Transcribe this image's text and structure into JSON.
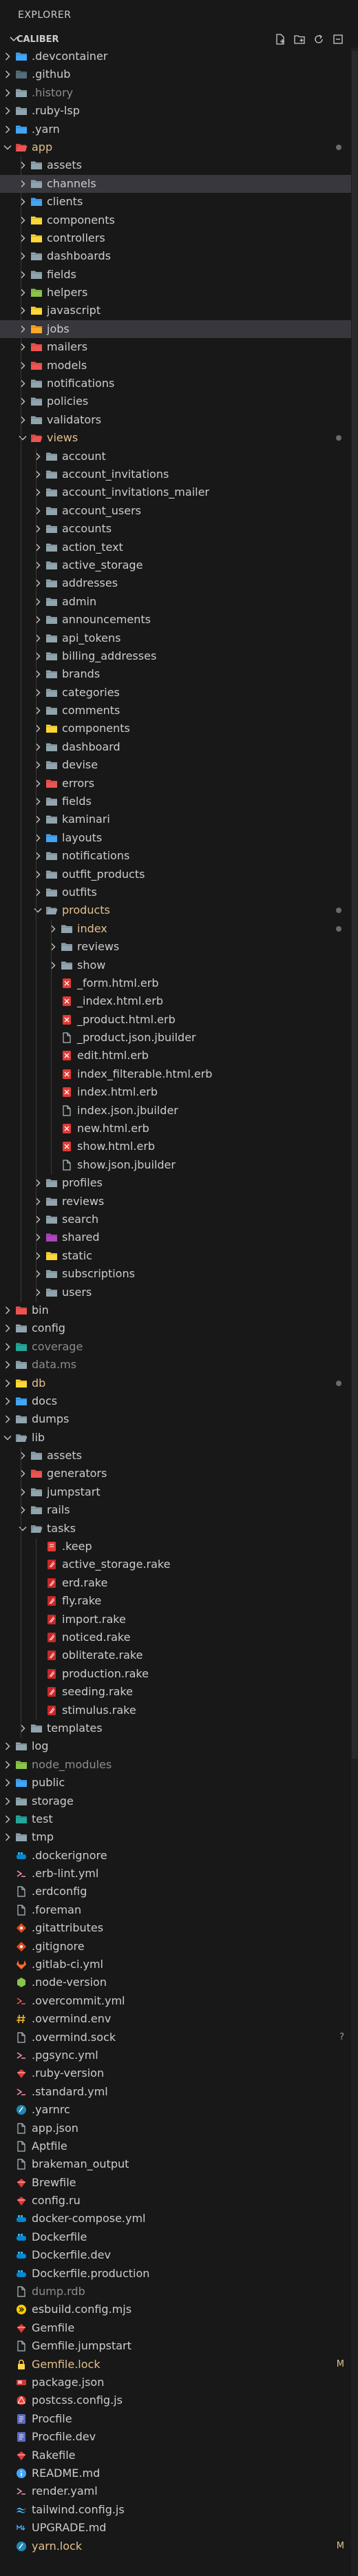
{
  "explorer": {
    "title": "EXPLORER"
  },
  "project": {
    "name": "CALIBER"
  },
  "actions": [
    "new-file-icon",
    "new-folder-icon",
    "refresh-icon",
    "collapse-all-icon"
  ],
  "colors": {
    "modified": "#e2c08d",
    "ignored": "#8c8c8c",
    "selected_row": "#37373d",
    "default_text": "#cccccc"
  },
  "tree": [
    {
      "depth": 0,
      "type": "folder",
      "open": false,
      "name": ".devcontainer",
      "icon": "folder-blue"
    },
    {
      "depth": 0,
      "type": "folder",
      "open": false,
      "name": ".github",
      "icon": "folder-dark"
    },
    {
      "depth": 0,
      "type": "folder",
      "open": false,
      "name": ".history",
      "icon": "folder-gray",
      "status": "ignored"
    },
    {
      "depth": 0,
      "type": "folder",
      "open": false,
      "name": ".ruby-lsp",
      "icon": "folder-gray"
    },
    {
      "depth": 0,
      "type": "folder",
      "open": false,
      "name": ".yarn",
      "icon": "folder-blue"
    },
    {
      "depth": 0,
      "type": "folder",
      "open": true,
      "name": "app",
      "icon": "folder-red",
      "status": "modified",
      "dot": true
    },
    {
      "depth": 1,
      "type": "folder",
      "open": false,
      "name": "assets",
      "icon": "folder-gray"
    },
    {
      "depth": 1,
      "type": "folder",
      "open": false,
      "name": "channels",
      "icon": "folder-gray",
      "selected": true
    },
    {
      "depth": 1,
      "type": "folder",
      "open": false,
      "name": "clients",
      "icon": "folder-blue"
    },
    {
      "depth": 1,
      "type": "folder",
      "open": false,
      "name": "components",
      "icon": "folder-yellow"
    },
    {
      "depth": 1,
      "type": "folder",
      "open": false,
      "name": "controllers",
      "icon": "folder-yellow"
    },
    {
      "depth": 1,
      "type": "folder",
      "open": false,
      "name": "dashboards",
      "icon": "folder-gray"
    },
    {
      "depth": 1,
      "type": "folder",
      "open": false,
      "name": "fields",
      "icon": "folder-gray"
    },
    {
      "depth": 1,
      "type": "folder",
      "open": false,
      "name": "helpers",
      "icon": "folder-green"
    },
    {
      "depth": 1,
      "type": "folder",
      "open": false,
      "name": "javascript",
      "icon": "folder-yellow"
    },
    {
      "depth": 1,
      "type": "folder",
      "open": false,
      "name": "jobs",
      "icon": "folder-orange",
      "selected": true
    },
    {
      "depth": 1,
      "type": "folder",
      "open": false,
      "name": "mailers",
      "icon": "folder-red"
    },
    {
      "depth": 1,
      "type": "folder",
      "open": false,
      "name": "models",
      "icon": "folder-red"
    },
    {
      "depth": 1,
      "type": "folder",
      "open": false,
      "name": "notifications",
      "icon": "folder-gray"
    },
    {
      "depth": 1,
      "type": "folder",
      "open": false,
      "name": "policies",
      "icon": "folder-gray"
    },
    {
      "depth": 1,
      "type": "folder",
      "open": false,
      "name": "validators",
      "icon": "folder-gray"
    },
    {
      "depth": 1,
      "type": "folder",
      "open": true,
      "name": "views",
      "icon": "folder-red",
      "status": "modified",
      "dot": true
    },
    {
      "depth": 2,
      "type": "folder",
      "open": false,
      "name": "account",
      "icon": "folder-gray"
    },
    {
      "depth": 2,
      "type": "folder",
      "open": false,
      "name": "account_invitations",
      "icon": "folder-gray"
    },
    {
      "depth": 2,
      "type": "folder",
      "open": false,
      "name": "account_invitations_mailer",
      "icon": "folder-gray"
    },
    {
      "depth": 2,
      "type": "folder",
      "open": false,
      "name": "account_users",
      "icon": "folder-gray"
    },
    {
      "depth": 2,
      "type": "folder",
      "open": false,
      "name": "accounts",
      "icon": "folder-gray"
    },
    {
      "depth": 2,
      "type": "folder",
      "open": false,
      "name": "action_text",
      "icon": "folder-gray"
    },
    {
      "depth": 2,
      "type": "folder",
      "open": false,
      "name": "active_storage",
      "icon": "folder-gray"
    },
    {
      "depth": 2,
      "type": "folder",
      "open": false,
      "name": "addresses",
      "icon": "folder-gray"
    },
    {
      "depth": 2,
      "type": "folder",
      "open": false,
      "name": "admin",
      "icon": "folder-gray"
    },
    {
      "depth": 2,
      "type": "folder",
      "open": false,
      "name": "announcements",
      "icon": "folder-gray"
    },
    {
      "depth": 2,
      "type": "folder",
      "open": false,
      "name": "api_tokens",
      "icon": "folder-gray"
    },
    {
      "depth": 2,
      "type": "folder",
      "open": false,
      "name": "billing_addresses",
      "icon": "folder-gray"
    },
    {
      "depth": 2,
      "type": "folder",
      "open": false,
      "name": "brands",
      "icon": "folder-gray"
    },
    {
      "depth": 2,
      "type": "folder",
      "open": false,
      "name": "categories",
      "icon": "folder-gray"
    },
    {
      "depth": 2,
      "type": "folder",
      "open": false,
      "name": "comments",
      "icon": "folder-gray"
    },
    {
      "depth": 2,
      "type": "folder",
      "open": false,
      "name": "components",
      "icon": "folder-yellow"
    },
    {
      "depth": 2,
      "type": "folder",
      "open": false,
      "name": "dashboard",
      "icon": "folder-gray"
    },
    {
      "depth": 2,
      "type": "folder",
      "open": false,
      "name": "devise",
      "icon": "folder-gray"
    },
    {
      "depth": 2,
      "type": "folder",
      "open": false,
      "name": "errors",
      "icon": "folder-red"
    },
    {
      "depth": 2,
      "type": "folder",
      "open": false,
      "name": "fields",
      "icon": "folder-gray"
    },
    {
      "depth": 2,
      "type": "folder",
      "open": false,
      "name": "kaminari",
      "icon": "folder-gray"
    },
    {
      "depth": 2,
      "type": "folder",
      "open": false,
      "name": "layouts",
      "icon": "folder-blue"
    },
    {
      "depth": 2,
      "type": "folder",
      "open": false,
      "name": "notifications",
      "icon": "folder-gray"
    },
    {
      "depth": 2,
      "type": "folder",
      "open": false,
      "name": "outfit_products",
      "icon": "folder-gray"
    },
    {
      "depth": 2,
      "type": "folder",
      "open": false,
      "name": "outfits",
      "icon": "folder-gray"
    },
    {
      "depth": 2,
      "type": "folder",
      "open": true,
      "name": "products",
      "icon": "folder-gray",
      "status": "modified",
      "dot": true
    },
    {
      "depth": 3,
      "type": "folder",
      "open": false,
      "name": "index",
      "icon": "folder-gray",
      "status": "modified",
      "dot": true
    },
    {
      "depth": 3,
      "type": "folder",
      "open": false,
      "name": "reviews",
      "icon": "folder-gray"
    },
    {
      "depth": 3,
      "type": "folder",
      "open": false,
      "name": "show",
      "icon": "folder-gray"
    },
    {
      "depth": 3,
      "type": "file",
      "name": "_form.html.erb",
      "icon": "erb"
    },
    {
      "depth": 3,
      "type": "file",
      "name": "_index.html.erb",
      "icon": "erb"
    },
    {
      "depth": 3,
      "type": "file",
      "name": "_product.html.erb",
      "icon": "erb"
    },
    {
      "depth": 3,
      "type": "file",
      "name": "_product.json.jbuilder",
      "icon": "doc"
    },
    {
      "depth": 3,
      "type": "file",
      "name": "edit.html.erb",
      "icon": "erb"
    },
    {
      "depth": 3,
      "type": "file",
      "name": "index_filterable.html.erb",
      "icon": "erb"
    },
    {
      "depth": 3,
      "type": "file",
      "name": "index.html.erb",
      "icon": "erb"
    },
    {
      "depth": 3,
      "type": "file",
      "name": "index.json.jbuilder",
      "icon": "doc"
    },
    {
      "depth": 3,
      "type": "file",
      "name": "new.html.erb",
      "icon": "erb"
    },
    {
      "depth": 3,
      "type": "file",
      "name": "show.html.erb",
      "icon": "erb"
    },
    {
      "depth": 3,
      "type": "file",
      "name": "show.json.jbuilder",
      "icon": "doc"
    },
    {
      "depth": 2,
      "type": "folder",
      "open": false,
      "name": "profiles",
      "icon": "folder-gray"
    },
    {
      "depth": 2,
      "type": "folder",
      "open": false,
      "name": "reviews",
      "icon": "folder-gray"
    },
    {
      "depth": 2,
      "type": "folder",
      "open": false,
      "name": "search",
      "icon": "folder-gray"
    },
    {
      "depth": 2,
      "type": "folder",
      "open": false,
      "name": "shared",
      "icon": "folder-purple"
    },
    {
      "depth": 2,
      "type": "folder",
      "open": false,
      "name": "static",
      "icon": "folder-yellow"
    },
    {
      "depth": 2,
      "type": "folder",
      "open": false,
      "name": "subscriptions",
      "icon": "folder-gray"
    },
    {
      "depth": 2,
      "type": "folder",
      "open": false,
      "name": "users",
      "icon": "folder-gray"
    },
    {
      "depth": 0,
      "type": "folder",
      "open": false,
      "name": "bin",
      "icon": "folder-red"
    },
    {
      "depth": 0,
      "type": "folder",
      "open": false,
      "name": "config",
      "icon": "folder-gray"
    },
    {
      "depth": 0,
      "type": "folder",
      "open": false,
      "name": "coverage",
      "icon": "folder-teal",
      "status": "ignored"
    },
    {
      "depth": 0,
      "type": "folder",
      "open": false,
      "name": "data.ms",
      "icon": "folder-gray",
      "status": "ignored"
    },
    {
      "depth": 0,
      "type": "folder",
      "open": false,
      "name": "db",
      "icon": "folder-yellow",
      "status": "modified",
      "dot": true
    },
    {
      "depth": 0,
      "type": "folder",
      "open": false,
      "name": "docs",
      "icon": "folder-blue"
    },
    {
      "depth": 0,
      "type": "folder",
      "open": false,
      "name": "dumps",
      "icon": "folder-gray"
    },
    {
      "depth": 0,
      "type": "folder",
      "open": true,
      "name": "lib",
      "icon": "folder-gray"
    },
    {
      "depth": 1,
      "type": "folder",
      "open": false,
      "name": "assets",
      "icon": "folder-gray"
    },
    {
      "depth": 1,
      "type": "folder",
      "open": false,
      "name": "generators",
      "icon": "folder-red"
    },
    {
      "depth": 1,
      "type": "folder",
      "open": false,
      "name": "jumpstart",
      "icon": "folder-gray"
    },
    {
      "depth": 1,
      "type": "folder",
      "open": false,
      "name": "rails",
      "icon": "folder-gray"
    },
    {
      "depth": 1,
      "type": "folder",
      "open": true,
      "name": "tasks",
      "icon": "folder-gray"
    },
    {
      "depth": 2,
      "type": "file",
      "name": ".keep",
      "icon": "keep"
    },
    {
      "depth": 2,
      "type": "file",
      "name": "active_storage.rake",
      "icon": "rake"
    },
    {
      "depth": 2,
      "type": "file",
      "name": "erd.rake",
      "icon": "rake"
    },
    {
      "depth": 2,
      "type": "file",
      "name": "fly.rake",
      "icon": "rake"
    },
    {
      "depth": 2,
      "type": "file",
      "name": "import.rake",
      "icon": "rake"
    },
    {
      "depth": 2,
      "type": "file",
      "name": "noticed.rake",
      "icon": "rake"
    },
    {
      "depth": 2,
      "type": "file",
      "name": "obliterate.rake",
      "icon": "rake"
    },
    {
      "depth": 2,
      "type": "file",
      "name": "production.rake",
      "icon": "rake"
    },
    {
      "depth": 2,
      "type": "file",
      "name": "seeding.rake",
      "icon": "rake"
    },
    {
      "depth": 2,
      "type": "file",
      "name": "stimulus.rake",
      "icon": "rake"
    },
    {
      "depth": 1,
      "type": "folder",
      "open": false,
      "name": "templates",
      "icon": "folder-gray"
    },
    {
      "depth": 0,
      "type": "folder",
      "open": false,
      "name": "log",
      "icon": "folder-gray"
    },
    {
      "depth": 0,
      "type": "folder",
      "open": false,
      "name": "node_modules",
      "icon": "folder-green",
      "status": "ignored"
    },
    {
      "depth": 0,
      "type": "folder",
      "open": false,
      "name": "public",
      "icon": "folder-blue"
    },
    {
      "depth": 0,
      "type": "folder",
      "open": false,
      "name": "storage",
      "icon": "folder-gray"
    },
    {
      "depth": 0,
      "type": "folder",
      "open": false,
      "name": "test",
      "icon": "folder-teal"
    },
    {
      "depth": 0,
      "type": "folder",
      "open": false,
      "name": "tmp",
      "icon": "folder-gray"
    },
    {
      "depth": 0,
      "type": "file",
      "name": ".dockerignore",
      "icon": "docker"
    },
    {
      "depth": 0,
      "type": "file",
      "name": ".erb-lint.yml",
      "icon": "yml"
    },
    {
      "depth": 0,
      "type": "file",
      "name": ".erdconfig",
      "icon": "doc"
    },
    {
      "depth": 0,
      "type": "file",
      "name": ".foreman",
      "icon": "doc"
    },
    {
      "depth": 0,
      "type": "file",
      "name": ".gitattributes",
      "icon": "git"
    },
    {
      "depth": 0,
      "type": "file",
      "name": ".gitignore",
      "icon": "git"
    },
    {
      "depth": 0,
      "type": "file",
      "name": ".gitlab-ci.yml",
      "icon": "gitlab"
    },
    {
      "depth": 0,
      "type": "file",
      "name": ".node-version",
      "icon": "node"
    },
    {
      "depth": 0,
      "type": "file",
      "name": ".overcommit.yml",
      "icon": "yml-red"
    },
    {
      "depth": 0,
      "type": "file",
      "name": ".overmind.env",
      "icon": "hash"
    },
    {
      "depth": 0,
      "type": "file",
      "name": ".overmind.sock",
      "icon": "doc",
      "deco": "?"
    },
    {
      "depth": 0,
      "type": "file",
      "name": ".pgsync.yml",
      "icon": "yml"
    },
    {
      "depth": 0,
      "type": "file",
      "name": ".ruby-version",
      "icon": "ruby"
    },
    {
      "depth": 0,
      "type": "file",
      "name": ".standard.yml",
      "icon": "yml"
    },
    {
      "depth": 0,
      "type": "file",
      "name": ".yarnrc",
      "icon": "yarn"
    },
    {
      "depth": 0,
      "type": "file",
      "name": "app.json",
      "icon": "doc"
    },
    {
      "depth": 0,
      "type": "file",
      "name": "Aptfile",
      "icon": "doc"
    },
    {
      "depth": 0,
      "type": "file",
      "name": "brakeman_output",
      "icon": "doc"
    },
    {
      "depth": 0,
      "type": "file",
      "name": "Brewfile",
      "icon": "ruby"
    },
    {
      "depth": 0,
      "type": "file",
      "name": "config.ru",
      "icon": "ruby"
    },
    {
      "depth": 0,
      "type": "file",
      "name": "docker-compose.yml",
      "icon": "docker"
    },
    {
      "depth": 0,
      "type": "file",
      "name": "Dockerfile",
      "icon": "docker"
    },
    {
      "depth": 0,
      "type": "file",
      "name": "Dockerfile.dev",
      "icon": "docker"
    },
    {
      "depth": 0,
      "type": "file",
      "name": "Dockerfile.production",
      "icon": "docker"
    },
    {
      "depth": 0,
      "type": "file",
      "name": "dump.rdb",
      "icon": "doc",
      "status": "ignored"
    },
    {
      "depth": 0,
      "type": "file",
      "name": "esbuild.config.mjs",
      "icon": "esbuild"
    },
    {
      "depth": 0,
      "type": "file",
      "name": "Gemfile",
      "icon": "ruby"
    },
    {
      "depth": 0,
      "type": "file",
      "name": "Gemfile.jumpstart",
      "icon": "doc"
    },
    {
      "depth": 0,
      "type": "file",
      "name": "Gemfile.lock",
      "icon": "lock",
      "status": "modified",
      "deco": "M"
    },
    {
      "depth": 0,
      "type": "file",
      "name": "package.json",
      "icon": "npm"
    },
    {
      "depth": 0,
      "type": "file",
      "name": "postcss.config.js",
      "icon": "postcss"
    },
    {
      "depth": 0,
      "type": "file",
      "name": "Procfile",
      "icon": "procfile"
    },
    {
      "depth": 0,
      "type": "file",
      "name": "Procfile.dev",
      "icon": "procfile"
    },
    {
      "depth": 0,
      "type": "file",
      "name": "Rakefile",
      "icon": "ruby"
    },
    {
      "depth": 0,
      "type": "file",
      "name": "README.md",
      "icon": "info"
    },
    {
      "depth": 0,
      "type": "file",
      "name": "render.yaml",
      "icon": "yml"
    },
    {
      "depth": 0,
      "type": "file",
      "name": "tailwind.config.js",
      "icon": "tailwind"
    },
    {
      "depth": 0,
      "type": "file",
      "name": "UPGRADE.md",
      "icon": "md"
    },
    {
      "depth": 0,
      "type": "file",
      "name": "yarn.lock",
      "icon": "yarn",
      "status": "modified",
      "deco": "M"
    }
  ]
}
